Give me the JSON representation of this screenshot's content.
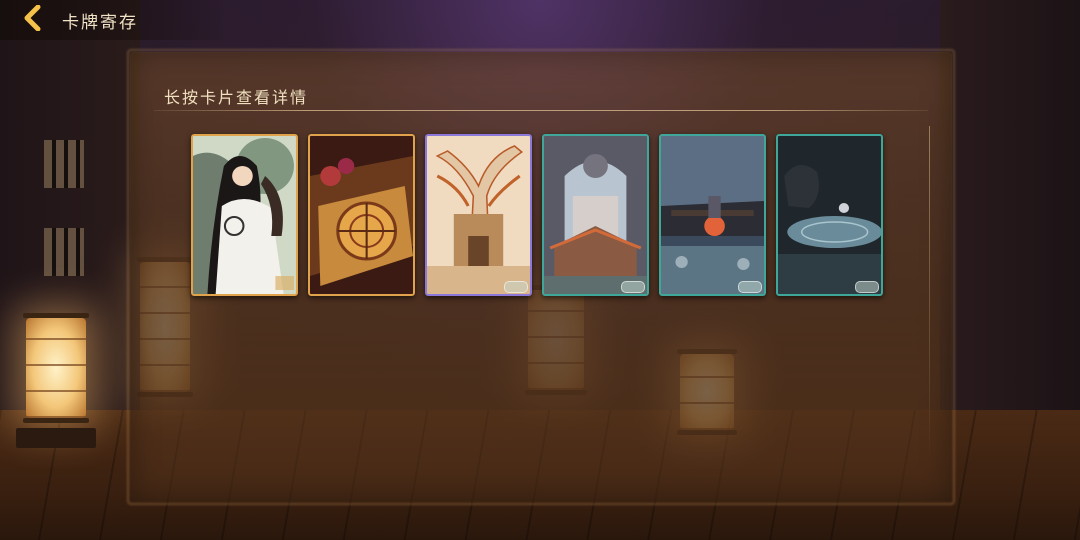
{
  "header": {
    "title": "卡牌寄存",
    "back_icon": "chevron-left-icon"
  },
  "panel": {
    "instruction": "长按卡片查看详情"
  },
  "cards": [
    {
      "frame_color": "#e0a24a",
      "art": "scholar-with-long-hair"
    },
    {
      "frame_color": "#e0a24a",
      "art": "compass-on-table"
    },
    {
      "frame_color": "#8c78d8",
      "art": "gate-with-dead-tree"
    },
    {
      "frame_color": "#3fa79a",
      "art": "temple-archway"
    },
    {
      "frame_color": "#3fa79a",
      "art": "courtyard-with-lantern"
    },
    {
      "frame_color": "#3fa79a",
      "art": "stone-disc-and-beast"
    }
  ],
  "colors": {
    "gold_frame": "#e0a24a",
    "purple_frame": "#8c78d8",
    "teal_frame": "#3fa79a",
    "text": "#f0e0c0"
  }
}
